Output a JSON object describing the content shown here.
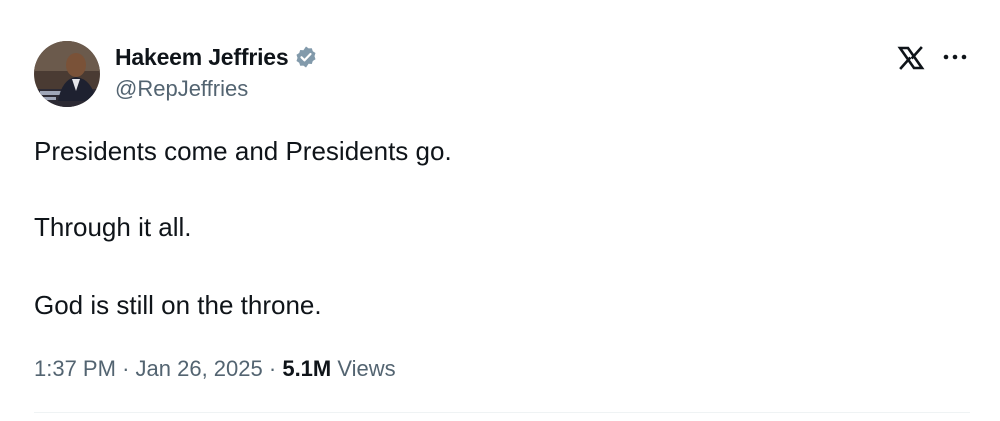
{
  "author": {
    "display_name": "Hakeem Jeffries",
    "handle": "@RepJeffries",
    "verified": true,
    "verified_color": "#829aab"
  },
  "header": {
    "logo_icon": "x-logo-icon",
    "more_icon": "more-horizontal-icon"
  },
  "tweet": {
    "lines": [
      "Presidents come and Presidents go.",
      "Through it all.",
      "God is still on the throne."
    ]
  },
  "meta": {
    "time": "1:37 PM",
    "separator": "·",
    "date": "Jan 26, 2025",
    "views_count": "5.1M",
    "views_label": "Views"
  }
}
